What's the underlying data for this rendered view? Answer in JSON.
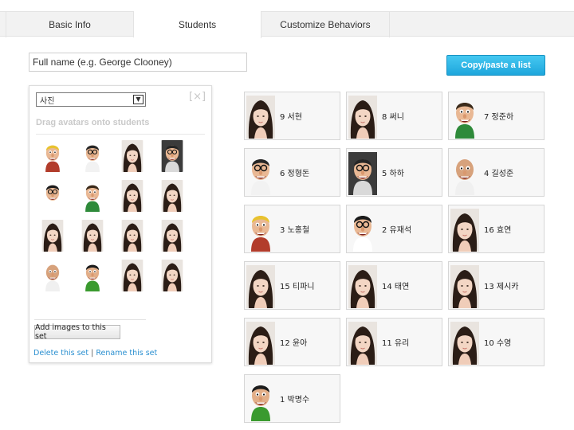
{
  "tabs": [
    {
      "label": "Basic Info",
      "active": false
    },
    {
      "label": "Students",
      "active": true
    },
    {
      "label": "Customize Behaviors",
      "active": false
    }
  ],
  "name_input": {
    "placeholder": "Full name (e.g. George Clooney)"
  },
  "copy_button": "Copy/paste a list",
  "avatar_panel": {
    "set_name": "사진",
    "close_label": "[×]",
    "drag_hint": "Drag avatars onto students",
    "add_images_label": "Add images to this set",
    "delete_link": "Delete this set",
    "separator": "|",
    "rename_link": "Rename this set",
    "avatars": [
      {
        "icon": "cartoon-blond-man-avatar"
      },
      {
        "icon": "cartoon-glasses-man-avatar"
      },
      {
        "icon": "girl-photo-avatar"
      },
      {
        "icon": "cartoon-glasses-man-dark-avatar"
      },
      {
        "icon": "cartoon-dancer-avatar"
      },
      {
        "icon": "cartoon-curly-man-avatar"
      },
      {
        "icon": "girl-photo-avatar"
      },
      {
        "icon": "girl-photo-avatar"
      },
      {
        "icon": "girl-photo-avatar"
      },
      {
        "icon": "girl-photo-avatar"
      },
      {
        "icon": "girl-photo-avatar"
      },
      {
        "icon": "girl-photo-avatar"
      },
      {
        "icon": "cartoon-bald-man-avatar"
      },
      {
        "icon": "cartoon-green-shirt-man-avatar"
      },
      {
        "icon": "girl-photo-avatar"
      },
      {
        "icon": "girl-photo-avatar"
      }
    ]
  },
  "students": [
    {
      "label": "9 서현",
      "avatar": "girl"
    },
    {
      "label": "8 써니",
      "avatar": "girl"
    },
    {
      "label": "7 정준하",
      "avatar": "cartoon-curly"
    },
    {
      "label": "6 정형돈",
      "avatar": "cartoon-glasses"
    },
    {
      "label": "5 하하",
      "avatar": "cartoon-glasses-dark"
    },
    {
      "label": "4 길성준",
      "avatar": "cartoon-bald"
    },
    {
      "label": "3 노홍철",
      "avatar": "cartoon-blond"
    },
    {
      "label": "2 유재석",
      "avatar": "cartoon-dancer"
    },
    {
      "label": "16 효연",
      "avatar": "girl"
    },
    {
      "label": "15 티파니",
      "avatar": "girl"
    },
    {
      "label": "14 태연",
      "avatar": "girl"
    },
    {
      "label": "13 제시카",
      "avatar": "girl"
    },
    {
      "label": "12 윤아",
      "avatar": "girl"
    },
    {
      "label": "11 유리",
      "avatar": "girl"
    },
    {
      "label": "10 수영",
      "avatar": "girl"
    },
    {
      "label": "1 박명수",
      "avatar": "cartoon-green"
    }
  ],
  "colors": {
    "accent": "#1ea6dc",
    "link": "#2a8fd0",
    "card_bg": "#f7f7f7"
  }
}
